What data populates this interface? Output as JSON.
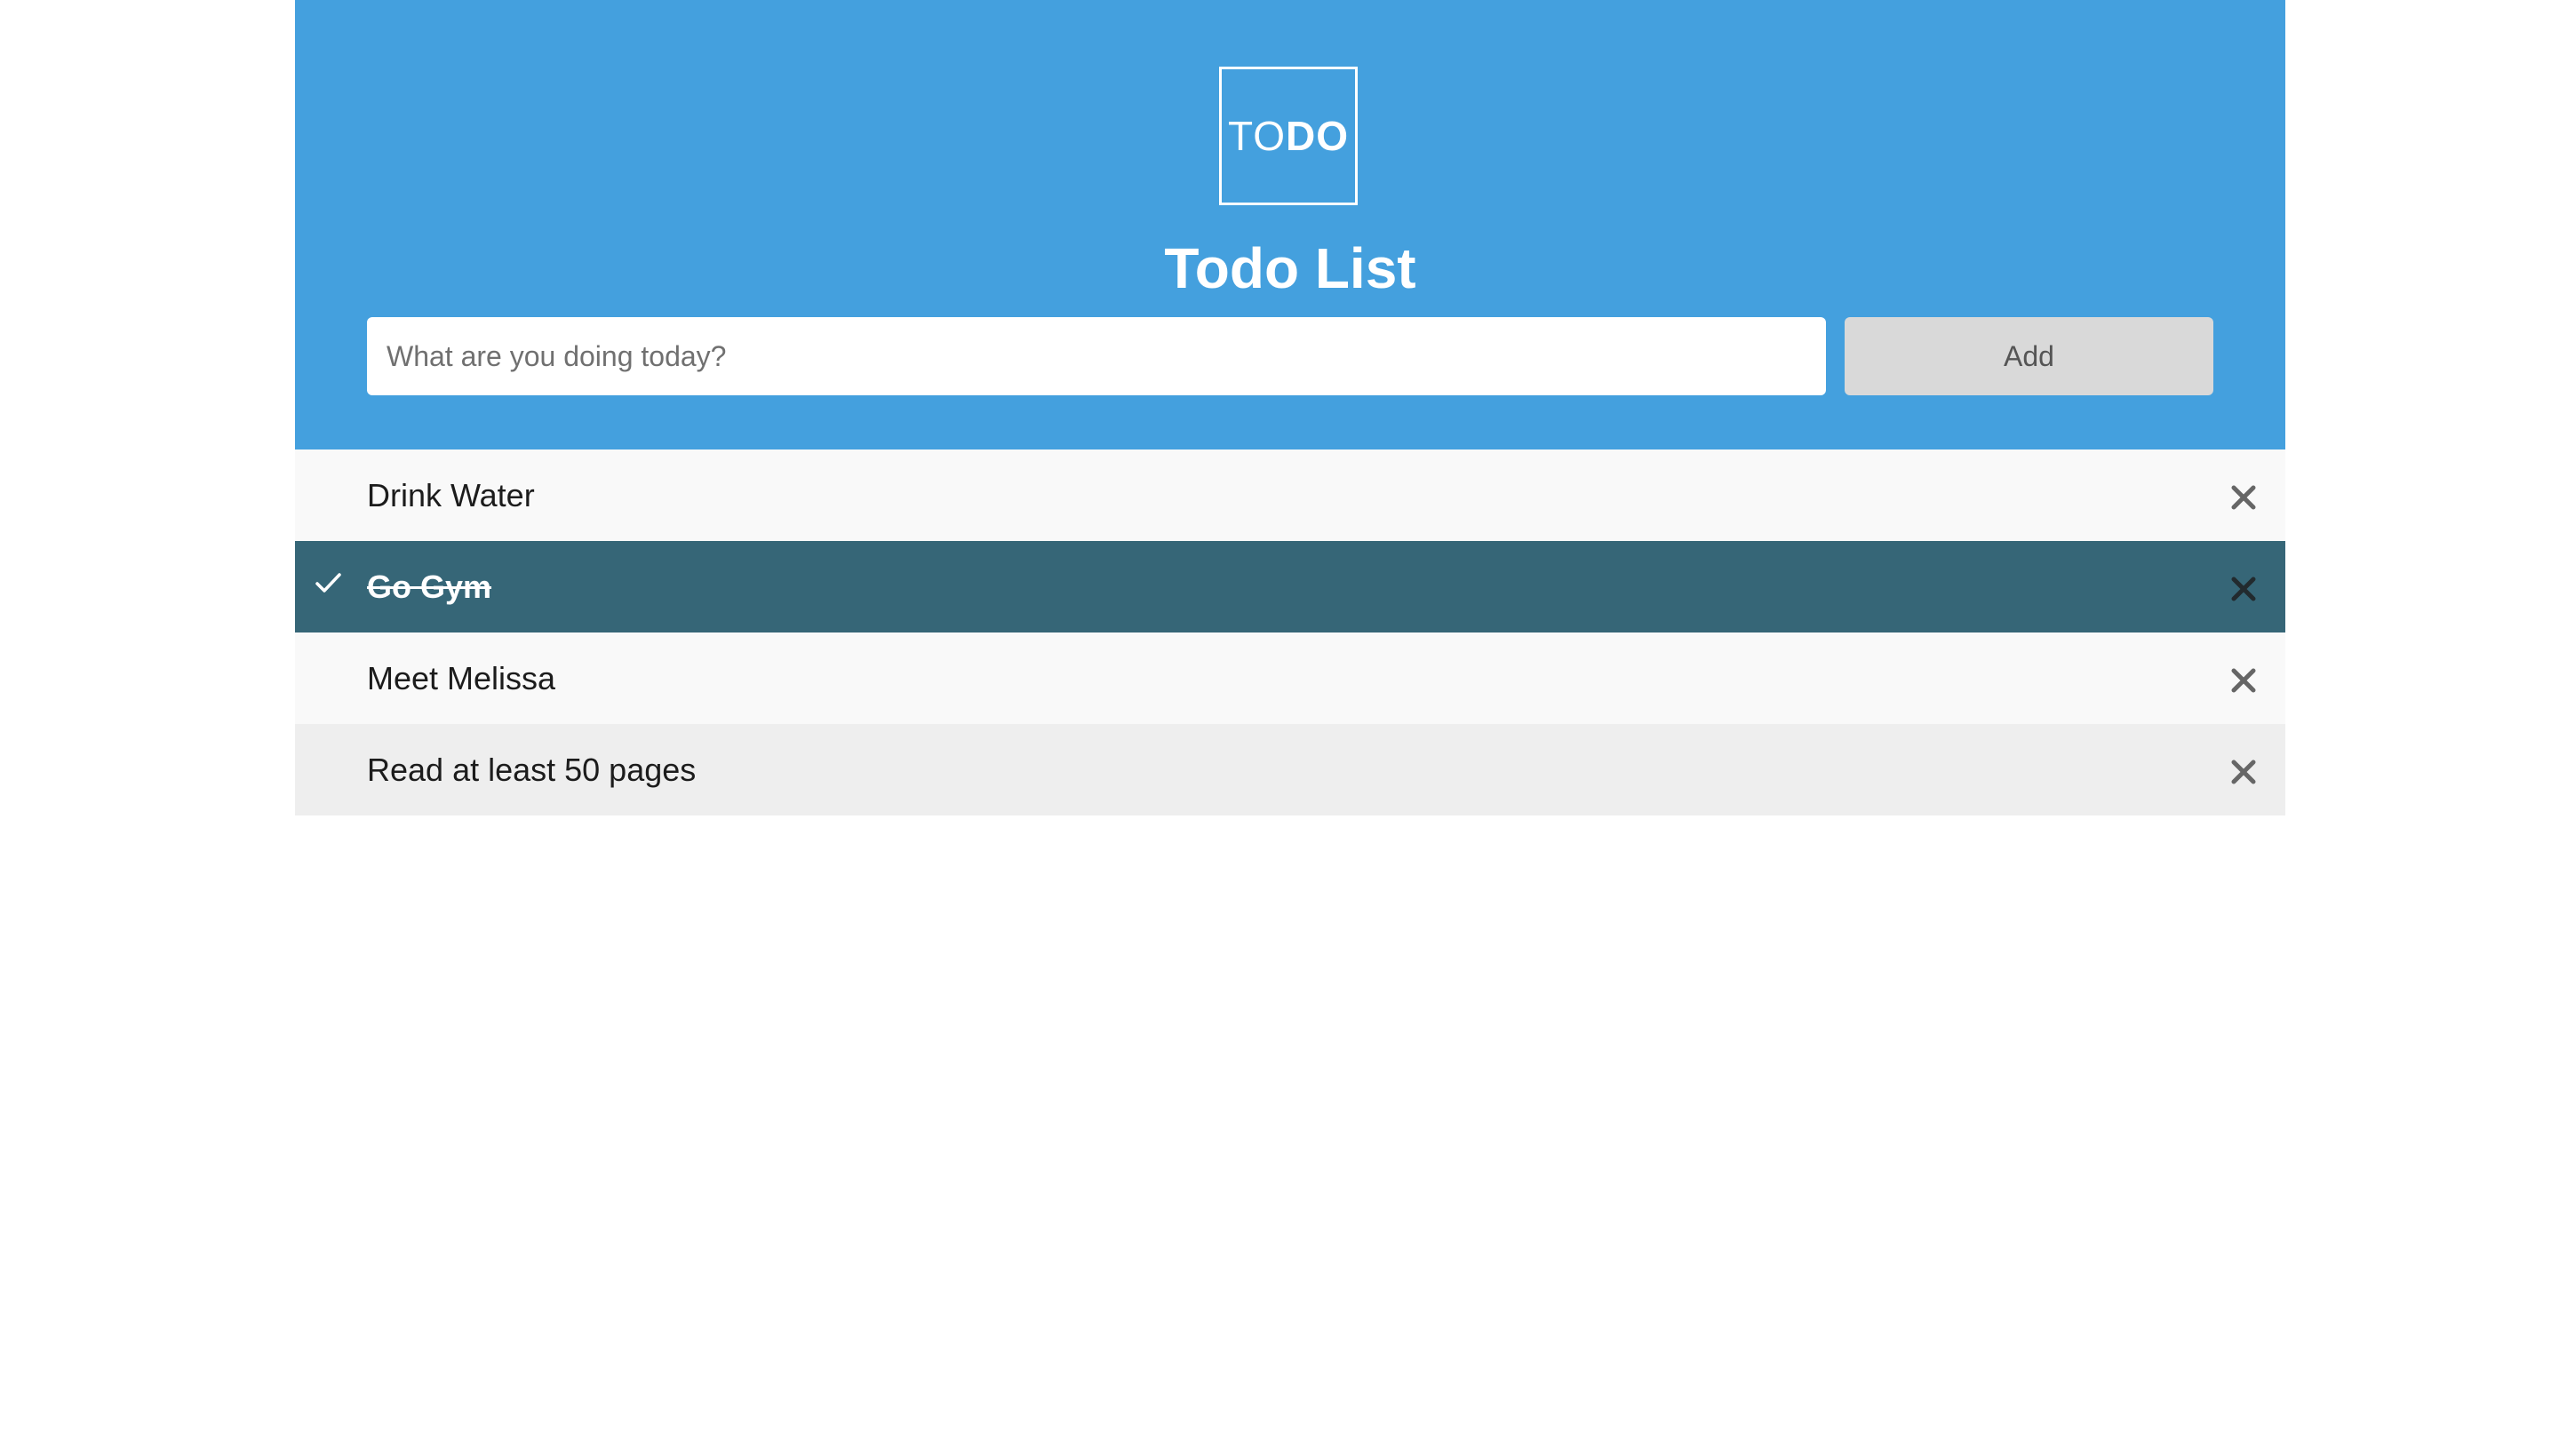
{
  "logo": {
    "part1": "TO",
    "part2": "DO"
  },
  "header": {
    "title": "Todo List"
  },
  "form": {
    "input_value": "",
    "placeholder": "What are you doing today?",
    "add_label": "Add"
  },
  "todos": [
    {
      "text": "Drink Water",
      "checked": false
    },
    {
      "text": "Go Gym",
      "checked": true
    },
    {
      "text": "Meet Melissa",
      "checked": false
    },
    {
      "text": "Read at least 50 pages",
      "checked": false
    }
  ],
  "icons": {
    "check": "check-icon",
    "close": "close-icon"
  },
  "colors": {
    "header_bg": "#44a0de",
    "checked_bg": "#366677",
    "row_bg": "#f9f9f9",
    "row_hover_bg": "#eeeeee",
    "button_bg": "#d9d9d9",
    "close_icon": "#666666"
  }
}
